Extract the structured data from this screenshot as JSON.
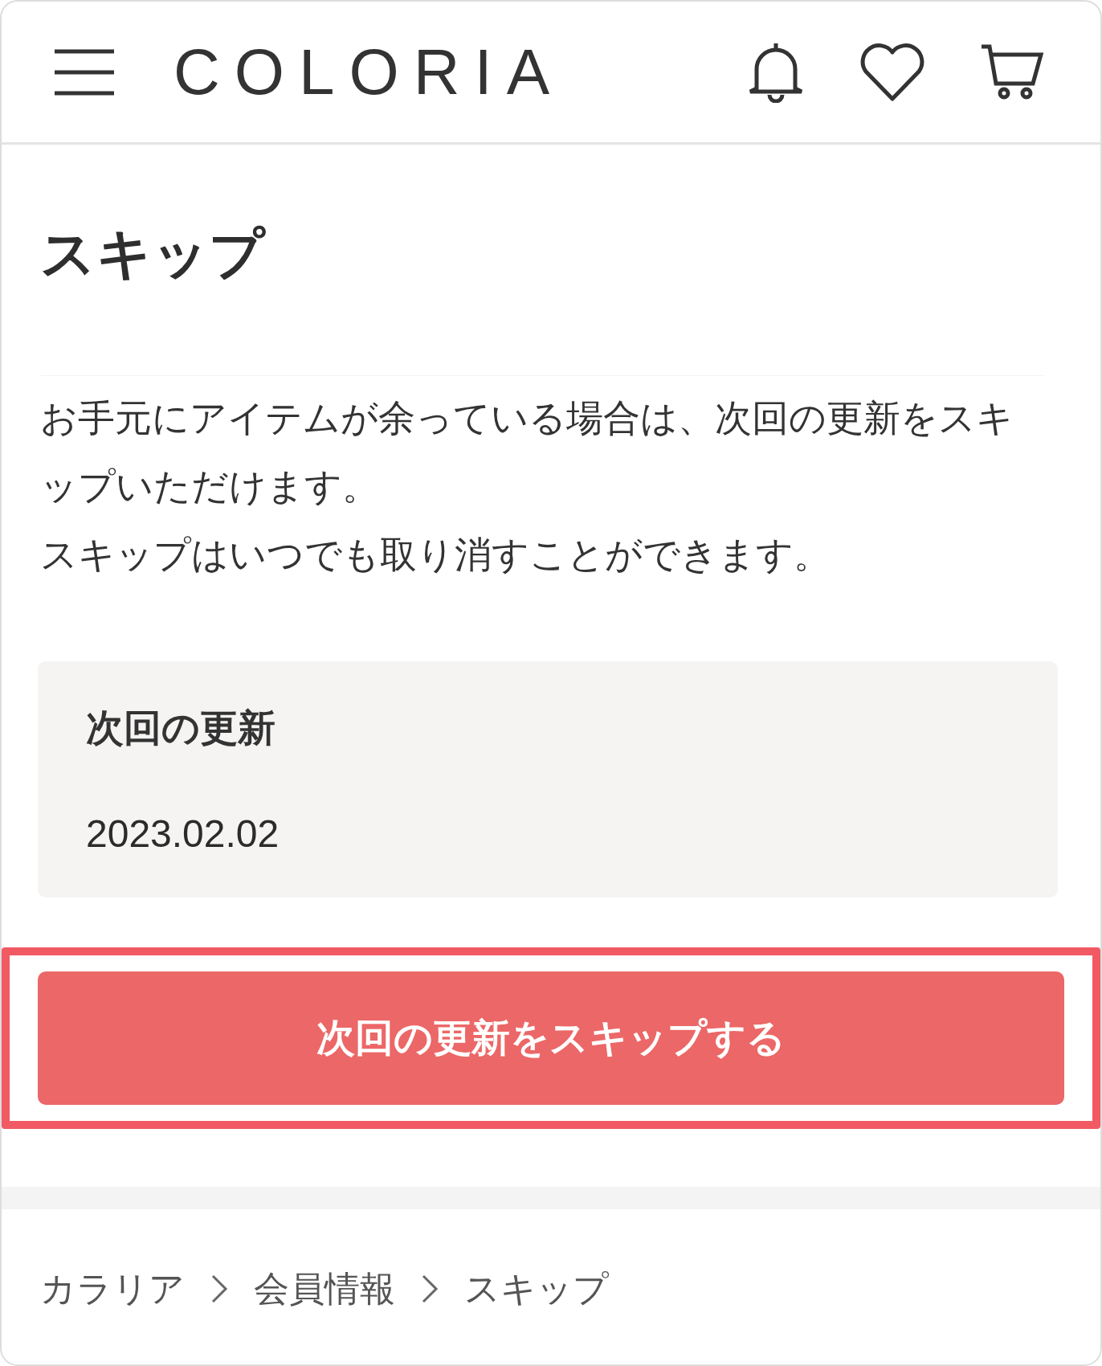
{
  "header": {
    "logo": "COLORIA"
  },
  "page": {
    "title": "スキップ",
    "description": [
      "お手元にアイテムが余っている場合は、次回の更新をスキップいただけます。",
      "スキップはいつでも取り消すことができます。"
    ]
  },
  "renewal_card": {
    "label": "次回の更新",
    "date": "2023.02.02"
  },
  "skip_button": {
    "label": "次回の更新をスキップする",
    "highlighted": true
  },
  "breadcrumb": [
    {
      "label": "カラリア"
    },
    {
      "label": "会員情報"
    },
    {
      "label": "スキップ"
    }
  ]
}
